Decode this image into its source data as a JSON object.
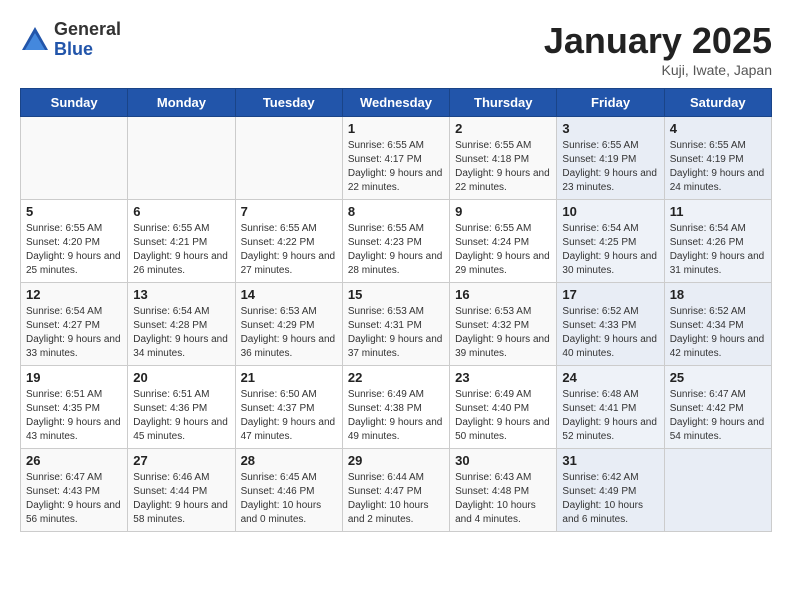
{
  "header": {
    "logo_general": "General",
    "logo_blue": "Blue",
    "month_title": "January 2025",
    "location": "Kuji, Iwate, Japan"
  },
  "weekdays": [
    "Sunday",
    "Monday",
    "Tuesday",
    "Wednesday",
    "Thursday",
    "Friday",
    "Saturday"
  ],
  "weeks": [
    [
      {
        "day": "",
        "info": ""
      },
      {
        "day": "",
        "info": ""
      },
      {
        "day": "",
        "info": ""
      },
      {
        "day": "1",
        "info": "Sunrise: 6:55 AM\nSunset: 4:17 PM\nDaylight: 9 hours\nand 22 minutes."
      },
      {
        "day": "2",
        "info": "Sunrise: 6:55 AM\nSunset: 4:18 PM\nDaylight: 9 hours\nand 22 minutes."
      },
      {
        "day": "3",
        "info": "Sunrise: 6:55 AM\nSunset: 4:19 PM\nDaylight: 9 hours\nand 23 minutes."
      },
      {
        "day": "4",
        "info": "Sunrise: 6:55 AM\nSunset: 4:19 PM\nDaylight: 9 hours\nand 24 minutes."
      }
    ],
    [
      {
        "day": "5",
        "info": "Sunrise: 6:55 AM\nSunset: 4:20 PM\nDaylight: 9 hours\nand 25 minutes."
      },
      {
        "day": "6",
        "info": "Sunrise: 6:55 AM\nSunset: 4:21 PM\nDaylight: 9 hours\nand 26 minutes."
      },
      {
        "day": "7",
        "info": "Sunrise: 6:55 AM\nSunset: 4:22 PM\nDaylight: 9 hours\nand 27 minutes."
      },
      {
        "day": "8",
        "info": "Sunrise: 6:55 AM\nSunset: 4:23 PM\nDaylight: 9 hours\nand 28 minutes."
      },
      {
        "day": "9",
        "info": "Sunrise: 6:55 AM\nSunset: 4:24 PM\nDaylight: 9 hours\nand 29 minutes."
      },
      {
        "day": "10",
        "info": "Sunrise: 6:54 AM\nSunset: 4:25 PM\nDaylight: 9 hours\nand 30 minutes."
      },
      {
        "day": "11",
        "info": "Sunrise: 6:54 AM\nSunset: 4:26 PM\nDaylight: 9 hours\nand 31 minutes."
      }
    ],
    [
      {
        "day": "12",
        "info": "Sunrise: 6:54 AM\nSunset: 4:27 PM\nDaylight: 9 hours\nand 33 minutes."
      },
      {
        "day": "13",
        "info": "Sunrise: 6:54 AM\nSunset: 4:28 PM\nDaylight: 9 hours\nand 34 minutes."
      },
      {
        "day": "14",
        "info": "Sunrise: 6:53 AM\nSunset: 4:29 PM\nDaylight: 9 hours\nand 36 minutes."
      },
      {
        "day": "15",
        "info": "Sunrise: 6:53 AM\nSunset: 4:31 PM\nDaylight: 9 hours\nand 37 minutes."
      },
      {
        "day": "16",
        "info": "Sunrise: 6:53 AM\nSunset: 4:32 PM\nDaylight: 9 hours\nand 39 minutes."
      },
      {
        "day": "17",
        "info": "Sunrise: 6:52 AM\nSunset: 4:33 PM\nDaylight: 9 hours\nand 40 minutes."
      },
      {
        "day": "18",
        "info": "Sunrise: 6:52 AM\nSunset: 4:34 PM\nDaylight: 9 hours\nand 42 minutes."
      }
    ],
    [
      {
        "day": "19",
        "info": "Sunrise: 6:51 AM\nSunset: 4:35 PM\nDaylight: 9 hours\nand 43 minutes."
      },
      {
        "day": "20",
        "info": "Sunrise: 6:51 AM\nSunset: 4:36 PM\nDaylight: 9 hours\nand 45 minutes."
      },
      {
        "day": "21",
        "info": "Sunrise: 6:50 AM\nSunset: 4:37 PM\nDaylight: 9 hours\nand 47 minutes."
      },
      {
        "day": "22",
        "info": "Sunrise: 6:49 AM\nSunset: 4:38 PM\nDaylight: 9 hours\nand 49 minutes."
      },
      {
        "day": "23",
        "info": "Sunrise: 6:49 AM\nSunset: 4:40 PM\nDaylight: 9 hours\nand 50 minutes."
      },
      {
        "day": "24",
        "info": "Sunrise: 6:48 AM\nSunset: 4:41 PM\nDaylight: 9 hours\nand 52 minutes."
      },
      {
        "day": "25",
        "info": "Sunrise: 6:47 AM\nSunset: 4:42 PM\nDaylight: 9 hours\nand 54 minutes."
      }
    ],
    [
      {
        "day": "26",
        "info": "Sunrise: 6:47 AM\nSunset: 4:43 PM\nDaylight: 9 hours\nand 56 minutes."
      },
      {
        "day": "27",
        "info": "Sunrise: 6:46 AM\nSunset: 4:44 PM\nDaylight: 9 hours\nand 58 minutes."
      },
      {
        "day": "28",
        "info": "Sunrise: 6:45 AM\nSunset: 4:46 PM\nDaylight: 10 hours\nand 0 minutes."
      },
      {
        "day": "29",
        "info": "Sunrise: 6:44 AM\nSunset: 4:47 PM\nDaylight: 10 hours\nand 2 minutes."
      },
      {
        "day": "30",
        "info": "Sunrise: 6:43 AM\nSunset: 4:48 PM\nDaylight: 10 hours\nand 4 minutes."
      },
      {
        "day": "31",
        "info": "Sunrise: 6:42 AM\nSunset: 4:49 PM\nDaylight: 10 hours\nand 6 minutes."
      },
      {
        "day": "",
        "info": ""
      }
    ]
  ]
}
